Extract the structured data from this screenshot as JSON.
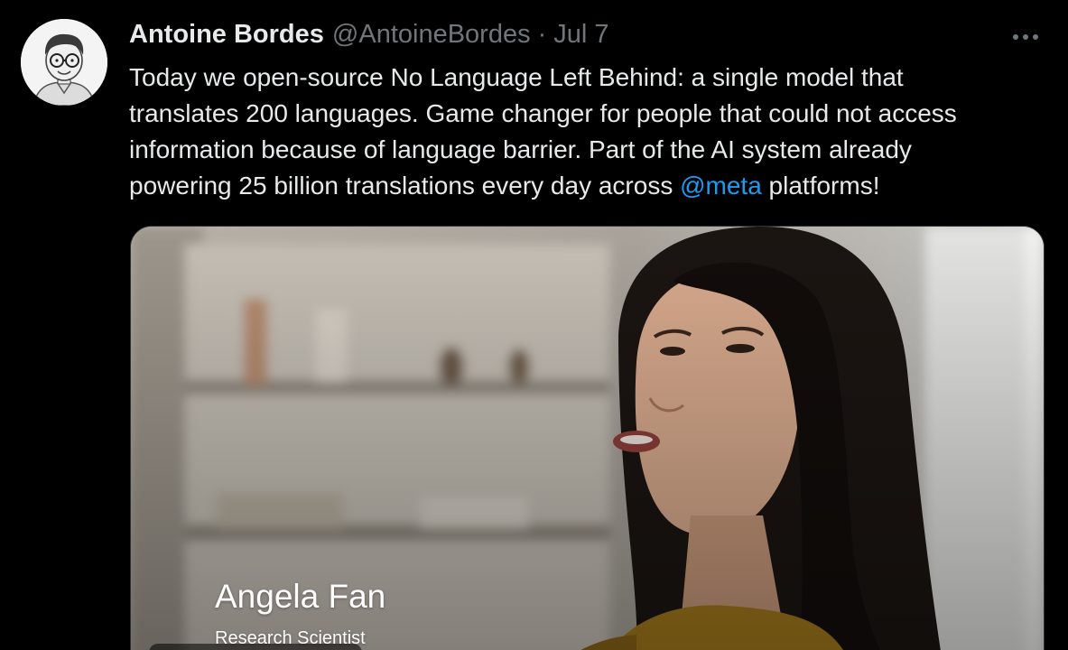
{
  "author": {
    "display_name": "Antoine Bordes",
    "handle": "@AntoineBordes",
    "separator": "·",
    "date": "Jul 7"
  },
  "tweet": {
    "lines": [
      "Today we open-source No Language Left Behind: a single model that",
      "translates 200 languages. Game changer for people that could not access",
      "information because of language barrier. Part of the AI system already"
    ],
    "last_line_before": "powering 25 billion translations every day across ",
    "mention": "@meta",
    "last_line_after": " platforms!"
  },
  "media": {
    "caption_name": "Angela Fan",
    "caption_title": "Research Scientist"
  },
  "colors": {
    "background": "#000000",
    "text": "#e7e9ea",
    "secondary": "#71767b",
    "link": "#1d9bf0"
  },
  "icons": {
    "more": "more-horizontal-icon"
  }
}
